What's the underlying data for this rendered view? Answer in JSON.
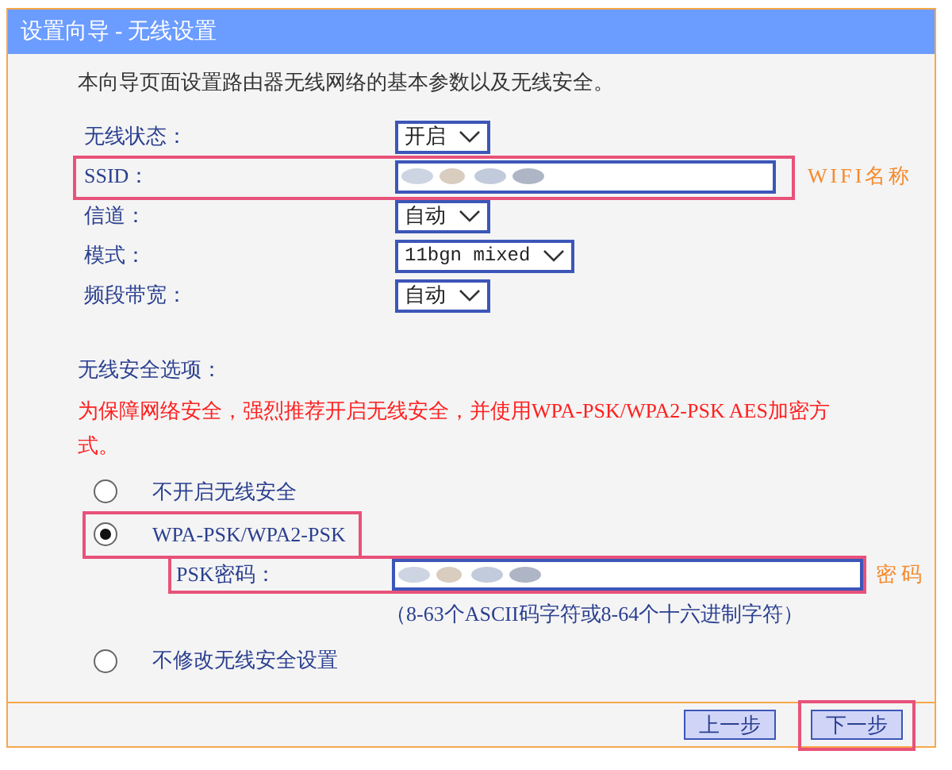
{
  "window": {
    "title": "设置向导 - 无线设置"
  },
  "intro": "本向导页面设置路由器无线网络的基本参数以及无线安全。",
  "fields": [
    {
      "label": "无线状态：",
      "kind": "select",
      "value": "开启",
      "highlighted": false
    },
    {
      "label": "SSID：",
      "kind": "text",
      "highlighted": true,
      "note": "WIFI名称"
    },
    {
      "label": "信道：",
      "kind": "select",
      "value": "自动",
      "highlighted": false
    },
    {
      "label": "模式：",
      "kind": "select",
      "value": "11bgn mixed",
      "highlighted": false
    },
    {
      "label": "频段带宽：",
      "kind": "select",
      "value": "自动",
      "highlighted": false
    }
  ],
  "security": {
    "heading": "无线安全选项：",
    "warning": "为保障网络安全，强烈推荐开启无线安全，并使用WPA-PSK/WPA2-PSK AES加密方式。",
    "options": [
      {
        "label": "不开启无线安全",
        "selected": false,
        "highlighted": false
      },
      {
        "label": "WPA-PSK/WPA2-PSK",
        "selected": true,
        "highlighted": true,
        "psk": {
          "label": "PSK密码：",
          "note": "密码",
          "hint": "（8-63个ASCII码字符或8-64个十六进制字符）"
        }
      },
      {
        "label": "不修改无线安全设置",
        "selected": false,
        "highlighted": false
      }
    ]
  },
  "buttons": [
    {
      "label": "上一步",
      "highlighted": false
    },
    {
      "label": "下一步",
      "highlighted": true
    }
  ]
}
